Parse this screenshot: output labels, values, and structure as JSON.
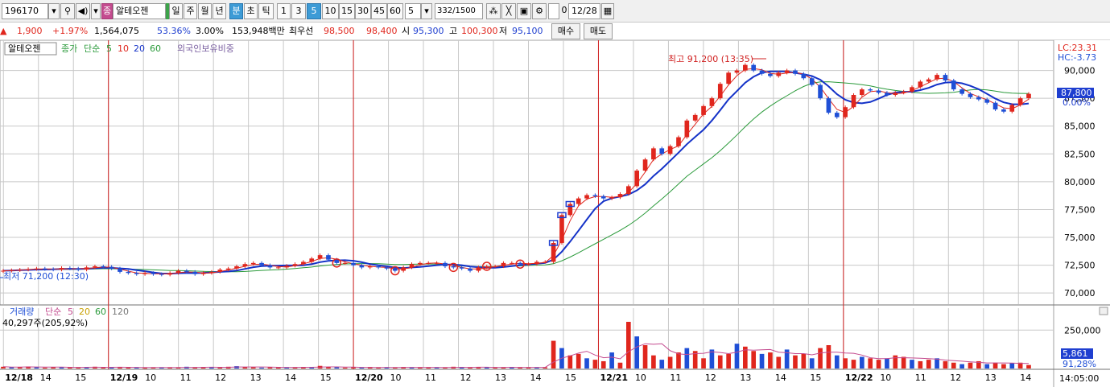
{
  "toolbar": {
    "stock_code": "196170",
    "stock_badge": "종",
    "stock_name": "알테오젠",
    "period_day": "일",
    "period_week": "주",
    "period_month": "월",
    "period_year": "년",
    "unit_minute": "분",
    "unit_second": "초",
    "unit_tick": "틱",
    "intervals": [
      "1",
      "3",
      "5",
      "10",
      "15",
      "30",
      "45",
      "60"
    ],
    "selected_interval": "5",
    "interval_select": "5",
    "count_current": "332",
    "count_total": "/1500",
    "checkbox_value": "0",
    "date_value": "12/28"
  },
  "info": {
    "change_arrow": "▲",
    "change": "1,900",
    "change_pct": "+1.97%",
    "volume": "1,564,075",
    "volume_ratio": "53.36%",
    "turnover": "3.00%",
    "trade_amount": "153,948백만",
    "best_ask_label": "최우선",
    "best_ask": "98,500",
    "best_bid": "98,400",
    "open_label": "시",
    "open": "95,300",
    "high_label": "고",
    "high": "100,300",
    "low_label": "저",
    "low": "95,100",
    "buy_button": "매수",
    "sell_button": "매도"
  },
  "legend": {
    "stock_name": "알테오젠",
    "price_label": "종가",
    "ma_type": "단순",
    "ma_periods": [
      "5",
      "10",
      "20",
      "60"
    ],
    "foreign_label": "외국인보유비중",
    "volume_label": "거래량",
    "volume_ma_type": "단순",
    "volume_ma_periods": [
      "5",
      "20",
      "60",
      "120"
    ],
    "volume_current": "40,297주(205,92%)"
  },
  "colors": {
    "up": "#e0261d",
    "down": "#1f4fd6",
    "ma5": "#e0261d",
    "ma10": "#1432c8",
    "ma20": "#2a9a3a",
    "vertical_divider": "#d02020",
    "grid": "#c8c8c8"
  },
  "chart_data": [
    {
      "type": "candlestick",
      "title": "알테오젠",
      "y_ticks": [
        "90,000",
        "87,500",
        "85,000",
        "82,500",
        "80,000",
        "77,500",
        "75,000",
        "72,500",
        "70,000"
      ],
      "ylim": [
        69000,
        92500
      ],
      "x_ticks": [
        "12/18",
        "14",
        "15",
        "12/19",
        "10",
        "11",
        "12",
        "13",
        "14",
        "15",
        "12/20",
        "10",
        "11",
        "12",
        "13",
        "14",
        "15",
        "12/21",
        "10",
        "11",
        "12",
        "13",
        "14",
        "15",
        "12/22",
        "10",
        "11",
        "12",
        "13",
        "14"
      ],
      "time_label": "14:05:00",
      "annotations": {
        "high": "최고 91,200 (13:35)",
        "low": "최저 71,200 (12:30)",
        "lc": "LC:23.31",
        "hc": "HC:-3.73"
      },
      "current_price": "87,800",
      "current_pct": "0.00%",
      "series_close": [
        72000,
        72050,
        72100,
        72150,
        72200,
        72150,
        72100,
        72250,
        72200,
        72100,
        72300,
        72400,
        72350,
        72200,
        71900,
        71800,
        71700,
        71800,
        71700,
        71650,
        71800,
        72000,
        71900,
        71700,
        71800,
        71900,
        72100,
        72200,
        72400,
        72600,
        72700,
        72500,
        72300,
        72300,
        72450,
        72600,
        72800,
        73100,
        73400,
        73000,
        72700,
        72700,
        72500,
        72300,
        72400,
        72300,
        72200,
        72000,
        72300,
        72600,
        72700,
        72700,
        72700,
        72400,
        72300,
        72200,
        72000,
        72300,
        72400,
        72400,
        72700,
        72700,
        72600,
        72600,
        72800,
        72800,
        74500,
        77000,
        78000,
        78500,
        78800,
        78700,
        78500,
        78600,
        78900,
        79600,
        81000,
        82000,
        83000,
        82500,
        83200,
        84000,
        85500,
        86000,
        86800,
        87500,
        88800,
        89800,
        90000,
        90500,
        90000,
        89700,
        89500,
        89800,
        90000,
        89700,
        89300,
        88700,
        87500,
        86200,
        85800,
        86700,
        87800,
        88300,
        88200,
        88000,
        87800,
        88000,
        88100,
        88500,
        89000,
        89200,
        89600,
        89100,
        88300,
        87900,
        87600,
        87400,
        87100,
        86500,
        86300,
        86900,
        87500,
        87900
      ],
      "series_ma5_label": "5",
      "series_ma10_label": "10",
      "series_ma20_label": "20",
      "series_ma60_label": "60"
    },
    {
      "type": "bar",
      "title": "거래량",
      "y_ticks": [
        "250,000"
      ],
      "ylim": [
        0,
        330000
      ],
      "current_volume": "5,861",
      "current_pct": "91,28%",
      "values": [
        6,
        4,
        5,
        7,
        4,
        3,
        5,
        4,
        5,
        3,
        4,
        6,
        3,
        5,
        4,
        3,
        4,
        2,
        3,
        4,
        3,
        4,
        6,
        3,
        5,
        4,
        3,
        6,
        8,
        5,
        4,
        3,
        4,
        5,
        3,
        4,
        5,
        4,
        9,
        5,
        4,
        3,
        4,
        3,
        5,
        3,
        4,
        3,
        5,
        4,
        3,
        4,
        3,
        4,
        6,
        4,
        3,
        5,
        4,
        3,
        4,
        5,
        3,
        4,
        3,
        4,
        95,
        70,
        45,
        50,
        35,
        30,
        25,
        55,
        20,
        160,
        110,
        80,
        45,
        30,
        40,
        55,
        70,
        60,
        35,
        65,
        45,
        50,
        85,
        75,
        60,
        50,
        55,
        40,
        65,
        45,
        50,
        35,
        70,
        80,
        45,
        35,
        30,
        40,
        35,
        30,
        35,
        45,
        40,
        30,
        25,
        30,
        35,
        25,
        20,
        15,
        20,
        25,
        15,
        20,
        15,
        18,
        20,
        12
      ]
    }
  ]
}
